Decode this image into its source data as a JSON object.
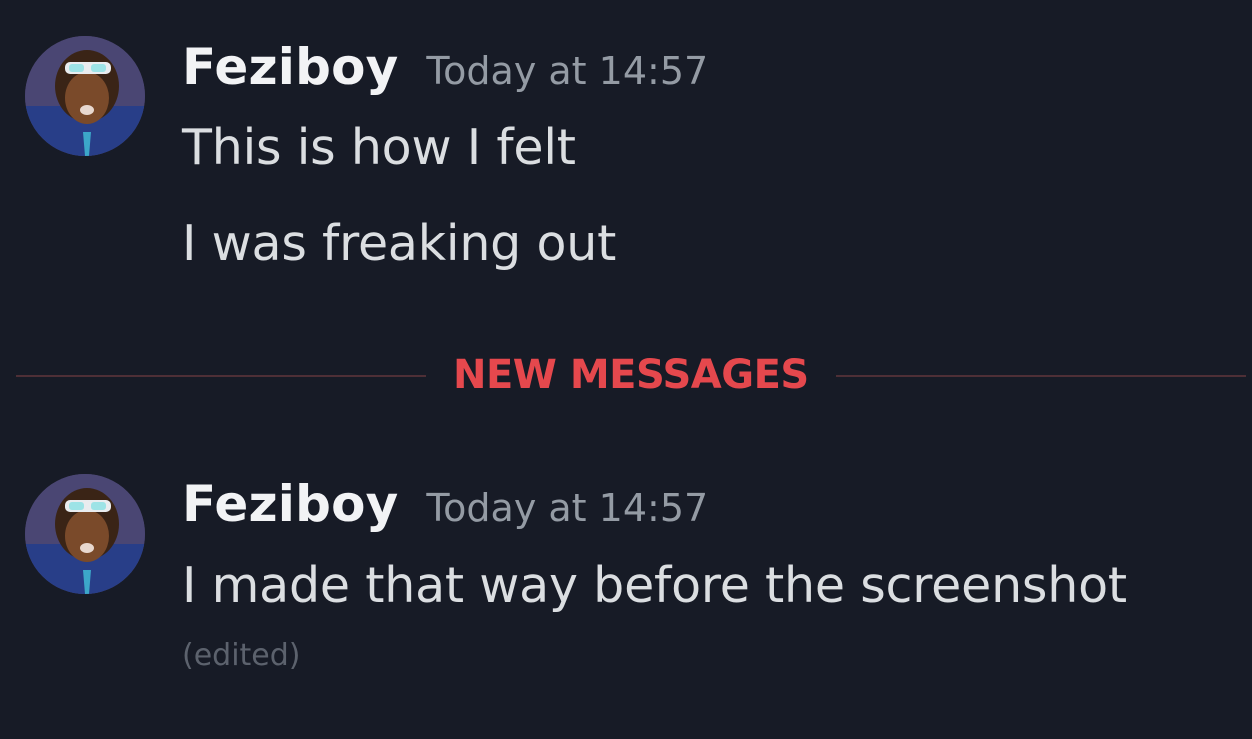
{
  "colors": {
    "background": "#171b26",
    "username": "#f2f3f5",
    "timestamp": "#949ba4",
    "message_text": "#dbdee1",
    "edited": "#5c626d",
    "new_messages": "#e5484d",
    "divider_line": "#4e2f36"
  },
  "messages": [
    {
      "username": "Feziboy",
      "timestamp": "Today at 14:57",
      "lines": [
        "This is how I felt",
        "I was freaking out"
      ]
    },
    {
      "username": "Feziboy",
      "timestamp": "Today at 14:57",
      "lines": [
        "I made that way before the screenshot"
      ],
      "edited_label": "(edited)"
    }
  ],
  "divider": {
    "label": "NEW MESSAGES"
  }
}
